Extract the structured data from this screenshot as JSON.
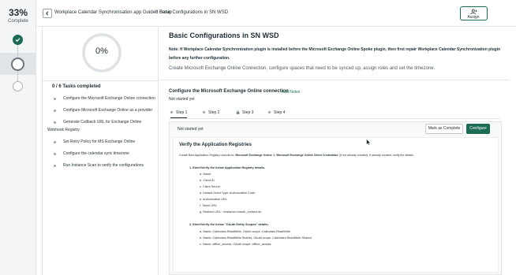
{
  "progress": {
    "percent_label": "33%",
    "status_label": "Complete"
  },
  "breadcrumb": {
    "parent": "Workplace Calendar Synchronisation app Guided Setup",
    "separator": ">",
    "current": "Basic Configurations in SN WSD"
  },
  "header": {
    "assign_label": "Assign"
  },
  "left_panel": {
    "ring_percent": "0%",
    "ring_value": 0,
    "tasks_title": "0 / 6 Tasks completed",
    "tasks": [
      {
        "line1": "Configure the Microsoft Exchange Online connection",
        "line2": ""
      },
      {
        "line1": "Configure Microsoft Exchange Online as a provider",
        "line2": ""
      },
      {
        "line1": "Generate Callback URL for Exchange Online",
        "line2": "Webhook Registry"
      },
      {
        "line1": "Set Retry Policy for MS Exchange Online",
        "line2": ""
      },
      {
        "line1": "Configure the calendar sync timezone",
        "line2": ""
      },
      {
        "line1": "Run Instance Scan to verify the configurations",
        "line2": ""
      }
    ]
  },
  "main": {
    "title": "Basic Configurations in SN WSD",
    "note": "Note: If Workplace Calendar Synchronization plugin is installed before the Microsoft Exchange Online Spoke plugin, then first repair Workplace Calendar Synchronization plugin before any further configuration.",
    "description": "Create Microsoft Exchange Online Connection, configure spaces that need to be synced up, assign roles and set the timezone.",
    "task_title": "Configure the Microsoft Exchange Online connection",
    "add_notes": "Add Notes",
    "task_status": "Not started yet",
    "tabs": [
      "Step 1",
      "Step 2",
      "Step 3",
      "Step 4"
    ],
    "card": {
      "status": "Not started yet",
      "mark_complete": "Mark as Complete",
      "configure": "Configure",
      "inner_title": "Verify the Application Registries",
      "intro_prefix": "Create New Application Registry records for '",
      "intro_bold1": "Microsoft Exchange Online",
      "intro_mid": "' & '",
      "intro_bold2": "Microsoft Exchange Online Client Credentials",
      "intro_suffix": "' (if not already created). If already created, verify the details.",
      "section1_title": "1. Enter/Verify the below Application Registry details-",
      "section1_items": [
        "a. Name",
        "b. Client ID",
        "c. Client Secret",
        "d. Default Grant Type: Authorization Code",
        "e. Authorization URL",
        "f. Token URL",
        "g. Redirect URL: <instance>/oauth_redirect.do"
      ],
      "section2_title": "2. Enter/Verify the below \"OAuth Entity Scopes\" details-",
      "section2_items": [
        "a. Name: Calendars.ReadWrite, OAuth scope: Calendars.ReadWrite",
        "b. Name: Calendars.ReadWrite.Shared, OAuth scope: Calendars.ReadWrite.Shared",
        "c. Name: offline_access, OAuth scope: offline_access"
      ]
    }
  }
}
